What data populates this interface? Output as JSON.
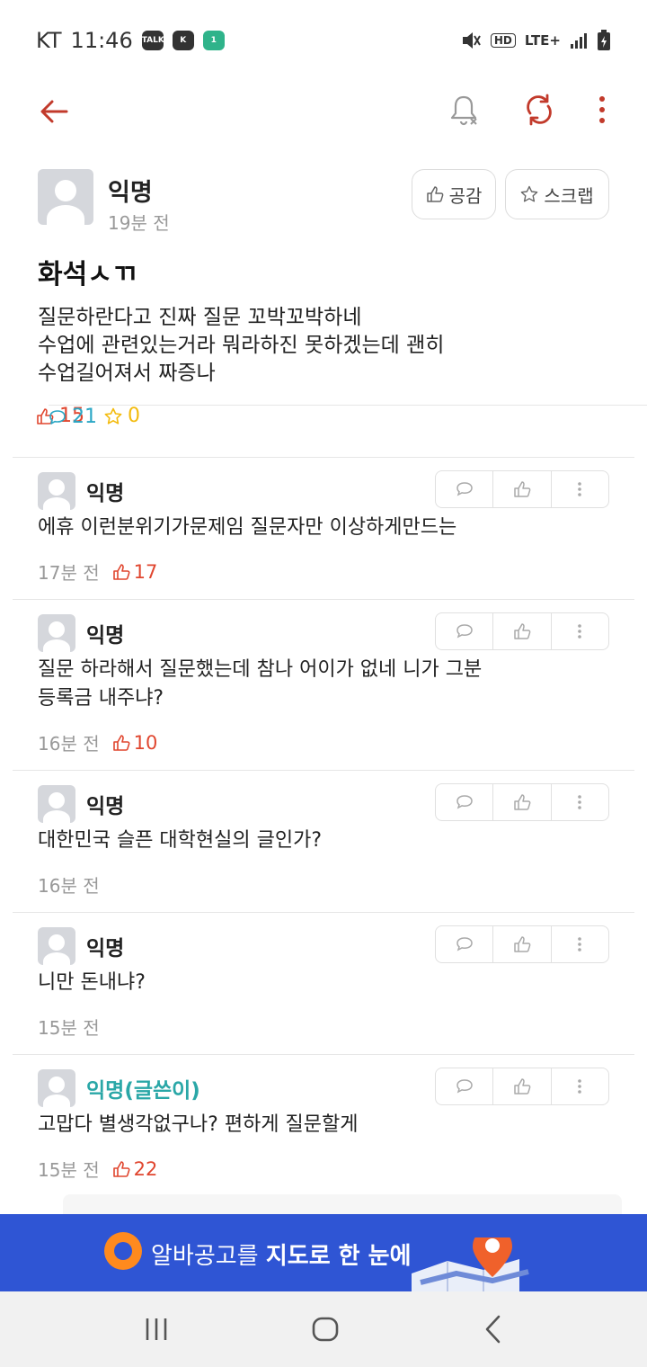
{
  "status_bar": {
    "carrier": "KT",
    "time": "11:46",
    "hd": "HD",
    "network": "LTE+"
  },
  "post": {
    "author": "익명",
    "time": "19분 전",
    "empathy_label": "공감",
    "scrap_label": "스크랩",
    "title": "화석ㅅㄲ",
    "body_lines": [
      "질문하란다고 진짜 질문 꼬박꼬박하네",
      "수업에 관련있는거라 뭐라하진 못하겠는데 괜히",
      "수업길어져서 짜증나"
    ],
    "likes": "15",
    "comments": "21",
    "scraps": "0"
  },
  "comments": [
    {
      "author": "익명",
      "lines": [
        "에휴 이런분위기가문제임 질문자만 이상하게만드는"
      ],
      "time": "17분 전",
      "likes": "17"
    },
    {
      "author": "익명",
      "lines": [
        "질문 하라해서 질문했는데 참나 어이가 없네 니가 그분",
        "등록금 내주냐?"
      ],
      "time": "16분 전",
      "likes": "10"
    },
    {
      "author": "익명",
      "lines": [
        "대한민국 슬픈 대학현실의 글인가?"
      ],
      "time": "16분 전",
      "likes": ""
    },
    {
      "author": "익명",
      "lines": [
        "니만 돈내냐?"
      ],
      "time": "15분 전",
      "likes": ""
    },
    {
      "author": "익명(글쓴이)",
      "lines": [
        "고맙다 별생각없구나? 편하게 질문할게"
      ],
      "time": "15분 전",
      "likes": "22"
    }
  ],
  "banner": {
    "text_normal": "알바공고를 ",
    "text_bold": "지도로 한 눈에"
  },
  "colors": {
    "accent": "#c23a2b",
    "like": "#e0462f",
    "comment": "#2aa7c5",
    "scrap": "#f3bb0d",
    "writer": "#2aa7a7",
    "banner": "#2f55d4"
  }
}
